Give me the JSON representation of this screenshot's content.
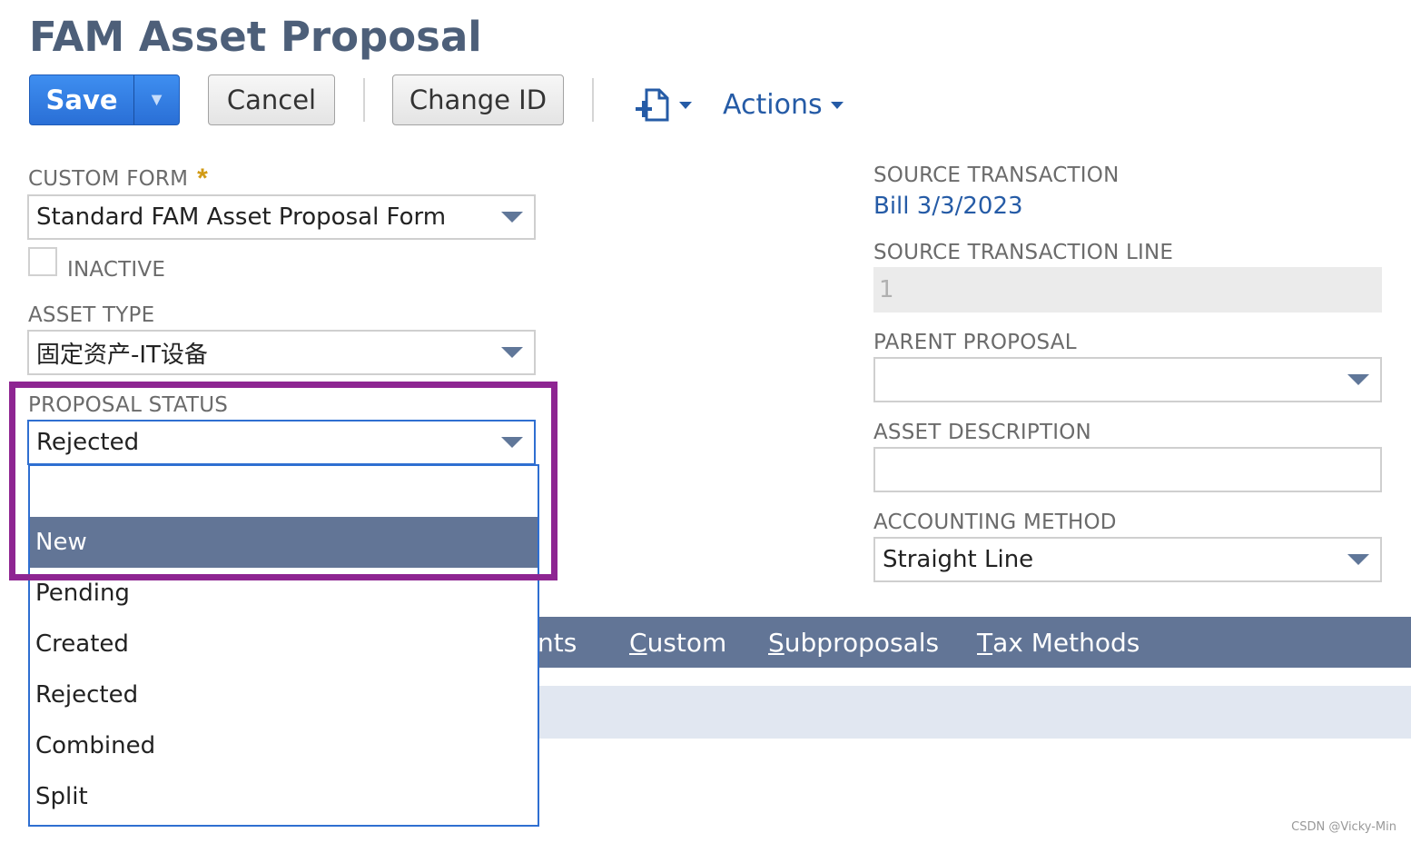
{
  "page": {
    "title": "FAM Asset Proposal"
  },
  "toolbar": {
    "save_label": "Save",
    "cancel_label": "Cancel",
    "change_id_label": "Change ID",
    "actions_label": "Actions"
  },
  "left_fields": {
    "custom_form": {
      "label": "CUSTOM FORM",
      "required_mark": "*",
      "value": "Standard FAM Asset Proposal Form"
    },
    "inactive": {
      "label": "INACTIVE",
      "checked": false
    },
    "asset_type": {
      "label": "ASSET TYPE",
      "value": "固定资产-IT设备"
    },
    "proposal_status": {
      "label": "PROPOSAL STATUS",
      "value": "Rejected",
      "options": [
        "",
        "New",
        "Pending",
        "Created",
        "Rejected",
        "Combined",
        "Split"
      ],
      "highlighted_option": "New"
    }
  },
  "right_fields": {
    "source_transaction": {
      "label": "SOURCE TRANSACTION",
      "value": "Bill 3/3/2023"
    },
    "source_transaction_line": {
      "label": "SOURCE TRANSACTION LINE",
      "value": "1"
    },
    "parent_proposal": {
      "label": "PARENT PROPOSAL",
      "value": ""
    },
    "asset_description": {
      "label": "ASSET DESCRIPTION",
      "value": ""
    },
    "accounting_method": {
      "label": "ACCOUNTING METHOD",
      "value": "Straight Line"
    }
  },
  "tabs": [
    {
      "partial": "nts"
    },
    {
      "first": "C",
      "rest": "ustom"
    },
    {
      "first": "S",
      "rest": "ubproposals"
    },
    {
      "first": "T",
      "rest": "ax Methods"
    }
  ],
  "colors": {
    "accent_blue": "#2a6fd6",
    "tab_bar": "#627596",
    "highlight": "#8e2592",
    "title": "#4d5f79",
    "link": "#255ba6"
  },
  "watermark": "CSDN @Vicky-Min"
}
